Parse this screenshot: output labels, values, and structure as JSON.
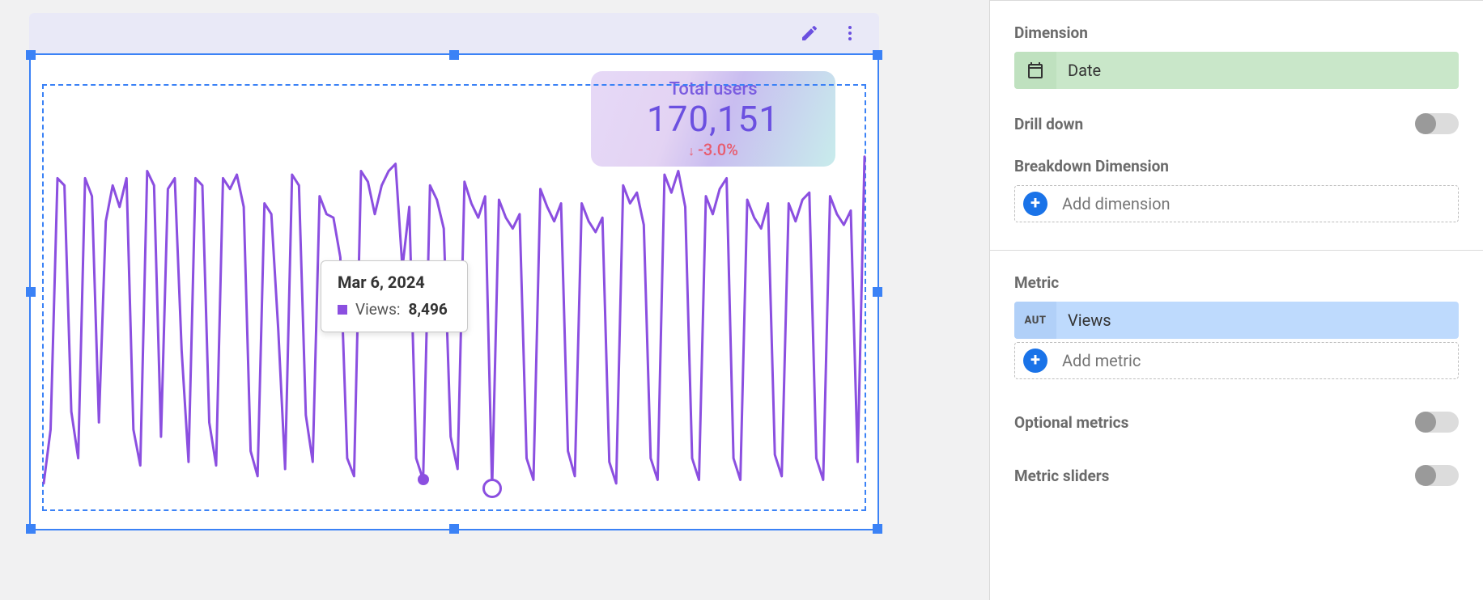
{
  "kpi": {
    "title": "Total users",
    "value": "170,151",
    "delta": "-3.0%",
    "delta_direction": "down"
  },
  "tooltip": {
    "date": "Mar 6, 2024",
    "metric_label": "Views:",
    "metric_value": "8,496"
  },
  "panel": {
    "dimension_label": "Dimension",
    "dimension_value": "Date",
    "drill_down_label": "Drill down",
    "breakdown_label": "Breakdown Dimension",
    "add_dimension_placeholder": "Add dimension",
    "metric_label": "Metric",
    "metric_badge": "AUT",
    "metric_value": "Views",
    "add_metric_placeholder": "Add metric",
    "optional_metrics_label": "Optional metrics",
    "metric_sliders_label": "Metric sliders"
  },
  "chart_data": {
    "type": "line",
    "title": "",
    "xlabel": "",
    "ylabel": "",
    "ylim": [
      0,
      10000
    ],
    "x_start": "Jan 1, 2024",
    "x_end": "Apr 30, 2024",
    "tooltip_point": {
      "x": "Mar 6, 2024",
      "y": 8496
    },
    "series": [
      {
        "name": "Views",
        "color": "#8b4fe0",
        "values": [
          500,
          2000,
          9000,
          8800,
          2500,
          1200,
          9000,
          8500,
          2200,
          7800,
          8800,
          8200,
          9000,
          2000,
          1000,
          9200,
          8800,
          1800,
          8700,
          9000,
          4200,
          1100,
          9000,
          8800,
          2200,
          1000,
          9000,
          8700,
          9100,
          8200,
          1400,
          700,
          8300,
          8000,
          4800,
          900,
          9100,
          8800,
          2400,
          1100,
          8500,
          8000,
          7900,
          6800,
          1200,
          700,
          9200,
          8900,
          8000,
          8800,
          9200,
          9400,
          6500,
          8200,
          1200,
          600,
          8800,
          8400,
          7600,
          1800,
          900,
          8900,
          8300,
          7900,
          8496,
          350,
          8400,
          7900,
          7600,
          8000,
          1200,
          600,
          8700,
          8200,
          7800,
          8300,
          1400,
          700,
          8300,
          7800,
          7500,
          7900,
          1100,
          500,
          8800,
          8300,
          8600,
          7700,
          1200,
          600,
          9100,
          8600,
          9200,
          8200,
          1200,
          600,
          8500,
          8000,
          8700,
          9000,
          1200,
          600,
          8400,
          7900,
          7600,
          8300,
          1300,
          700,
          8300,
          7800,
          8400,
          8600,
          1200,
          600,
          8500,
          8000,
          7700,
          8100,
          1100,
          9600
        ]
      }
    ]
  }
}
